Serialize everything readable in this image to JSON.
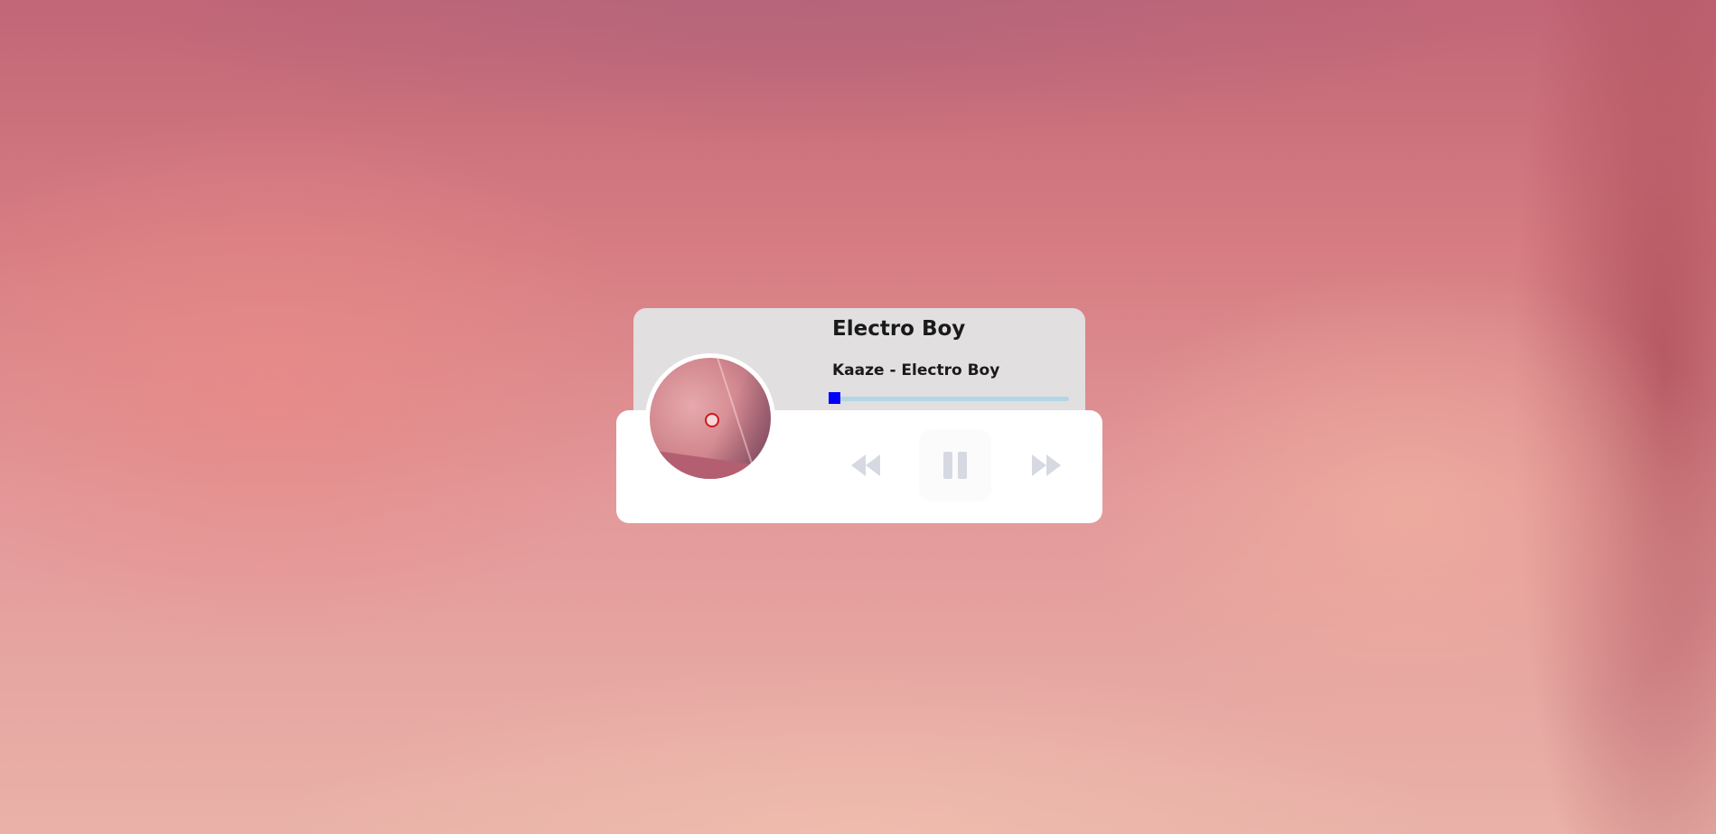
{
  "track": {
    "title": "Electro Boy",
    "subtitle": "Kaaze - Electro Boy",
    "progress": 0.0
  },
  "controls": {
    "prev_icon": "backward-icon",
    "play_state_icon": "pause-icon",
    "next_icon": "forward-icon"
  },
  "colors": {
    "progress_track": "#b3d6e6",
    "progress_handle": "#0000ff",
    "control_icon": "#d6d9e2",
    "info_panel": "#e1dfdf"
  }
}
